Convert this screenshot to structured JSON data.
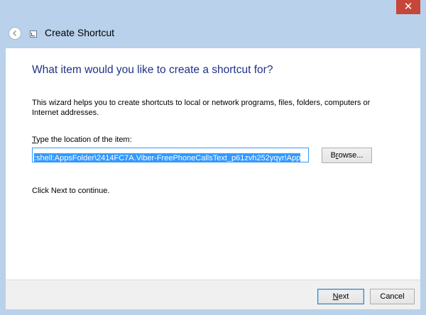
{
  "window": {
    "title": "Create Shortcut",
    "close_glyph": "✕"
  },
  "icons": {
    "back": "back-arrow-icon",
    "title": "shortcut-icon",
    "close": "close-icon"
  },
  "colors": {
    "frame": "#b9d1ea",
    "heading": "#1e3287",
    "selection": "#3399ff",
    "close": "#c7463a"
  },
  "main": {
    "heading": "What item would you like to create a shortcut for?",
    "description": "This wizard helps you to create shortcuts to local or network programs, files, folders, computers or Internet addresses.",
    "location_label_mnemonic": "T",
    "location_label_rest": "ype the location of the item:",
    "location_value": ":shell:AppsFolder\\2414FC7A.Viber-FreePhoneCallsText_p61zvh252yqyr!App",
    "browse_label_mnemonic": "r",
    "browse_label_pre": "B",
    "browse_label_post": "owse...",
    "hint": "Click Next to continue."
  },
  "footer": {
    "next_mnemonic": "N",
    "next_rest": "ext",
    "cancel_label": "Cancel"
  }
}
